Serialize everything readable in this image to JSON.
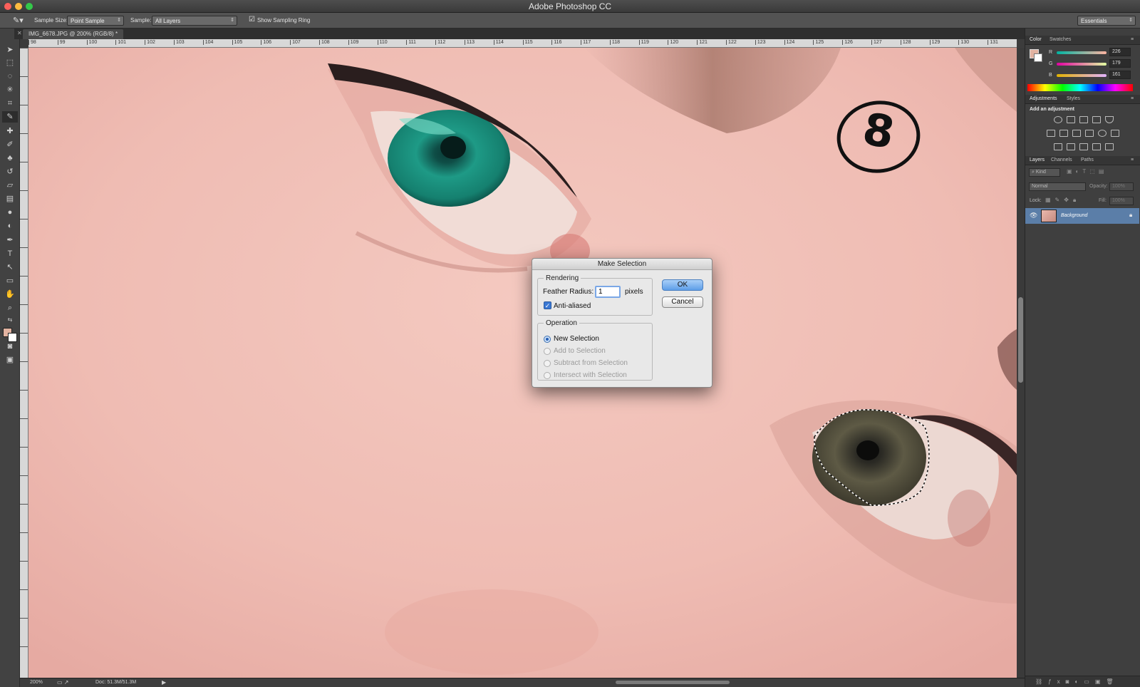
{
  "app": {
    "title": "Adobe Photoshop CC"
  },
  "options_bar": {
    "sample_size_label": "Sample Size:",
    "sample_size_value": "Point Sample",
    "sample_label": "Sample:",
    "sample_value": "All Layers",
    "sampling_ring_label": "Show Sampling Ring",
    "workspace": "Essentials"
  },
  "document": {
    "tab_label": "IMG_6678.JPG @ 200% (RGB/8) *"
  },
  "ruler": {
    "ticks": [
      "98",
      "99",
      "100",
      "101",
      "102",
      "103",
      "104",
      "105",
      "106",
      "107",
      "108",
      "109",
      "110",
      "111",
      "112",
      "113",
      "114",
      "115",
      "116",
      "117",
      "118",
      "119",
      "120",
      "121",
      "122",
      "123",
      "124",
      "125",
      "126",
      "127",
      "128",
      "129",
      "130",
      "131"
    ]
  },
  "annotation": {
    "step_number": "8"
  },
  "status": {
    "zoom": "200%",
    "doc_info": "Doc: 51.3M/51.3M"
  },
  "color_panel": {
    "tabs": [
      "Color",
      "Swatches"
    ],
    "channels": [
      {
        "label": "R",
        "value": "226"
      },
      {
        "label": "G",
        "value": "179"
      },
      {
        "label": "B",
        "value": "161"
      }
    ],
    "foreground": "#e2b3a1"
  },
  "adjustments_panel": {
    "tabs": [
      "Adjustments",
      "Styles"
    ],
    "heading": "Add an adjustment"
  },
  "layers_panel": {
    "tabs": [
      "Layers",
      "Channels",
      "Paths"
    ],
    "filter_kind": "Kind",
    "blend_mode": "Normal",
    "opacity_label": "Opacity:",
    "opacity_value": "100%",
    "lock_label": "Lock:",
    "fill_label": "Fill:",
    "fill_value": "100%",
    "layers": [
      {
        "name": "Background"
      }
    ]
  },
  "dialog": {
    "title": "Make Selection",
    "rendering_legend": "Rendering",
    "feather_label": "Feather Radius:",
    "feather_value": "1",
    "feather_unit": "pixels",
    "antialiased_label": "Anti-aliased",
    "operation_legend": "Operation",
    "operations": [
      "New Selection",
      "Add to Selection",
      "Subtract from Selection",
      "Intersect with Selection"
    ],
    "ok_label": "OK",
    "cancel_label": "Cancel"
  }
}
